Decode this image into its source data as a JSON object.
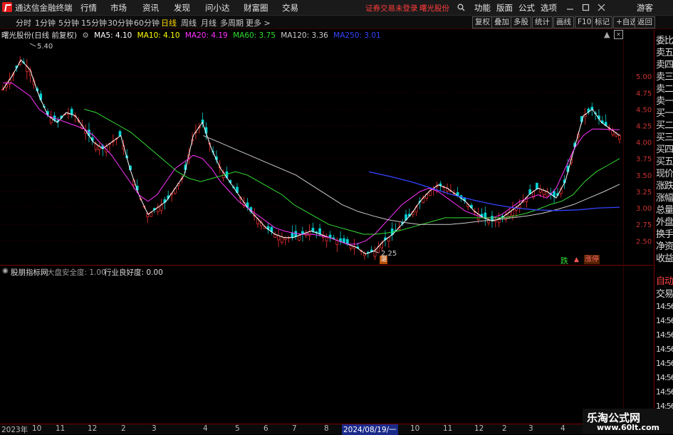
{
  "app": {
    "title": "通达信金融终端"
  },
  "menu": [
    "行情",
    "市场",
    "资讯",
    "发现",
    "问小达",
    "财富圈",
    "交易"
  ],
  "status": {
    "login_text": "证券交易未登录",
    "stock_name": "曙光股份"
  },
  "right_menu": [
    "功能",
    "版面",
    "公式",
    "选项"
  ],
  "user": "游客",
  "timeframes": [
    "分时",
    "1分钟",
    "5分钟",
    "15分钟",
    "30分钟",
    "60分钟",
    "日线",
    "周线",
    "月线",
    "多周期",
    "更多 >"
  ],
  "active_timeframe": "日线",
  "tools": [
    "复权",
    "叠加",
    "多股",
    "统计",
    "画线",
    "F10",
    "标记",
    "+自选",
    "返回"
  ],
  "legend": {
    "title": "曙光股份(日线 前复权)",
    "ma5": "MA5: 4.10",
    "ma10": "MA10: 4.10",
    "ma20": "MA20: 4.19",
    "ma60": "MA60: 3.75",
    "ma120": "MA120: 3.36",
    "ma250": "MA250: 3.01",
    "colors": {
      "ma5": "#ffffff",
      "ma10": "#ffff00",
      "ma20": "#ff33ff",
      "ma60": "#33dd33",
      "ma120": "#cccccc",
      "ma250": "#3344ff"
    }
  },
  "price_axis": [
    "5.00",
    "4.75",
    "4.50",
    "4.25",
    "4.00",
    "3.75",
    "3.50",
    "3.25",
    "3.00",
    "2.75",
    "2.50"
  ],
  "high_label": "5.40",
  "low_label": "2.25",
  "tags": {
    "die": "跌",
    "zhangting": "涨停"
  },
  "sub_indicator": {
    "name": "股朋指标网",
    "field1": "大盘安全度: 1.00",
    "field2": "行业良好度: 0.00"
  },
  "right_panel": {
    "labels": [
      "委比",
      "卖五",
      "卖四",
      "卖三",
      "卖二",
      "卖一",
      "买一",
      "买二",
      "买三",
      "买四",
      "买五",
      "现价",
      "涨跌",
      "涨幅",
      "总量",
      "外盘",
      "换手",
      "净资",
      "收益"
    ],
    "auto": "自动",
    "trade": "交易",
    "times": [
      "14:56",
      "14:56",
      "14:56",
      "14:56",
      "14:56",
      "14:56",
      "14:56",
      "14:56"
    ]
  },
  "date_axis": [
    "2023年",
    "10",
    "11",
    "12",
    "2",
    "3",
    "4",
    "5",
    "6",
    "7",
    "8",
    "2024/08/19/一",
    "10",
    "11",
    "12",
    "2",
    "3",
    "4"
  ],
  "watermark": {
    "line1": "乐淘公式网",
    "line2": "www.60lt.com"
  },
  "chart_data": {
    "type": "candlestick",
    "title": "曙光股份(日线 前复权)",
    "ylim": [
      2.2,
      5.5
    ],
    "high": 5.4,
    "low": 2.25,
    "close_path": [
      4.8,
      5.0,
      5.25,
      5.1,
      4.7,
      4.4,
      4.3,
      4.45,
      4.4,
      4.2,
      4.0,
      3.9,
      4.0,
      4.1,
      3.6,
      3.2,
      2.9,
      3.0,
      3.1,
      3.3,
      3.5,
      4.1,
      4.3,
      3.9,
      3.6,
      3.4,
      3.2,
      3.0,
      2.85,
      2.7,
      2.6,
      2.55,
      2.55,
      2.6,
      2.65,
      2.6,
      2.55,
      2.5,
      2.45,
      2.4,
      2.3,
      2.35,
      2.5,
      2.6,
      2.75,
      2.9,
      3.1,
      3.25,
      3.35,
      3.3,
      3.2,
      3.1,
      2.95,
      2.85,
      2.8,
      2.85,
      2.95,
      3.05,
      3.2,
      3.3,
      3.25,
      3.15,
      3.4,
      3.9,
      4.4,
      4.5,
      4.3,
      4.2,
      4.1
    ],
    "ma20_path": [
      4.9,
      4.9,
      4.8,
      4.7,
      4.5,
      4.4,
      4.35,
      4.3,
      4.25,
      4.2,
      4.1,
      3.95,
      3.8,
      3.6,
      3.4,
      3.2,
      3.1,
      3.2,
      3.4,
      3.6,
      3.7,
      3.8,
      3.75,
      3.6,
      3.4,
      3.25,
      3.1,
      3.0,
      2.9,
      2.8,
      2.7,
      2.65,
      2.62,
      2.6,
      2.6,
      2.58,
      2.55,
      2.5,
      2.45,
      2.45,
      2.5,
      2.6,
      2.75,
      2.9,
      3.05,
      3.15,
      3.25,
      3.3,
      3.25,
      3.15,
      3.05,
      2.95,
      2.9,
      2.85,
      2.85,
      2.9,
      3.0,
      3.1,
      3.15,
      3.2,
      3.15,
      3.3,
      3.6,
      3.9,
      4.1,
      4.2,
      4.2,
      4.19
    ],
    "ma60_path": [
      null,
      null,
      null,
      null,
      null,
      null,
      null,
      4.5,
      4.45,
      4.35,
      4.25,
      4.15,
      4.0,
      3.85,
      3.7,
      3.55,
      3.45,
      3.4,
      3.45,
      3.5,
      3.55,
      3.5,
      3.4,
      3.3,
      3.2,
      3.05,
      2.95,
      2.85,
      2.75,
      2.7,
      2.65,
      2.6,
      2.6,
      2.62,
      2.65,
      2.7,
      2.75,
      2.8,
      2.85,
      2.85,
      2.85,
      2.85,
      2.85,
      2.85,
      2.88,
      2.92,
      2.98,
      3.05,
      3.1,
      3.2,
      3.4,
      3.55,
      3.65,
      3.75
    ],
    "ma120_path": [
      null,
      null,
      null,
      null,
      null,
      null,
      null,
      null,
      null,
      null,
      null,
      null,
      null,
      4.1,
      4.0,
      3.9,
      3.8,
      3.7,
      3.6,
      3.5,
      3.35,
      3.2,
      3.05,
      2.95,
      2.88,
      2.82,
      2.78,
      2.75,
      2.75,
      2.75,
      2.77,
      2.8,
      2.82,
      2.85,
      2.88,
      2.92,
      2.98,
      3.05,
      3.15,
      3.25,
      3.36
    ],
    "ma250_path": [
      3.55,
      3.48,
      3.4,
      3.3,
      3.2,
      3.12,
      3.05,
      3.0,
      2.97,
      2.96,
      2.97,
      3.0,
      3.01
    ]
  }
}
